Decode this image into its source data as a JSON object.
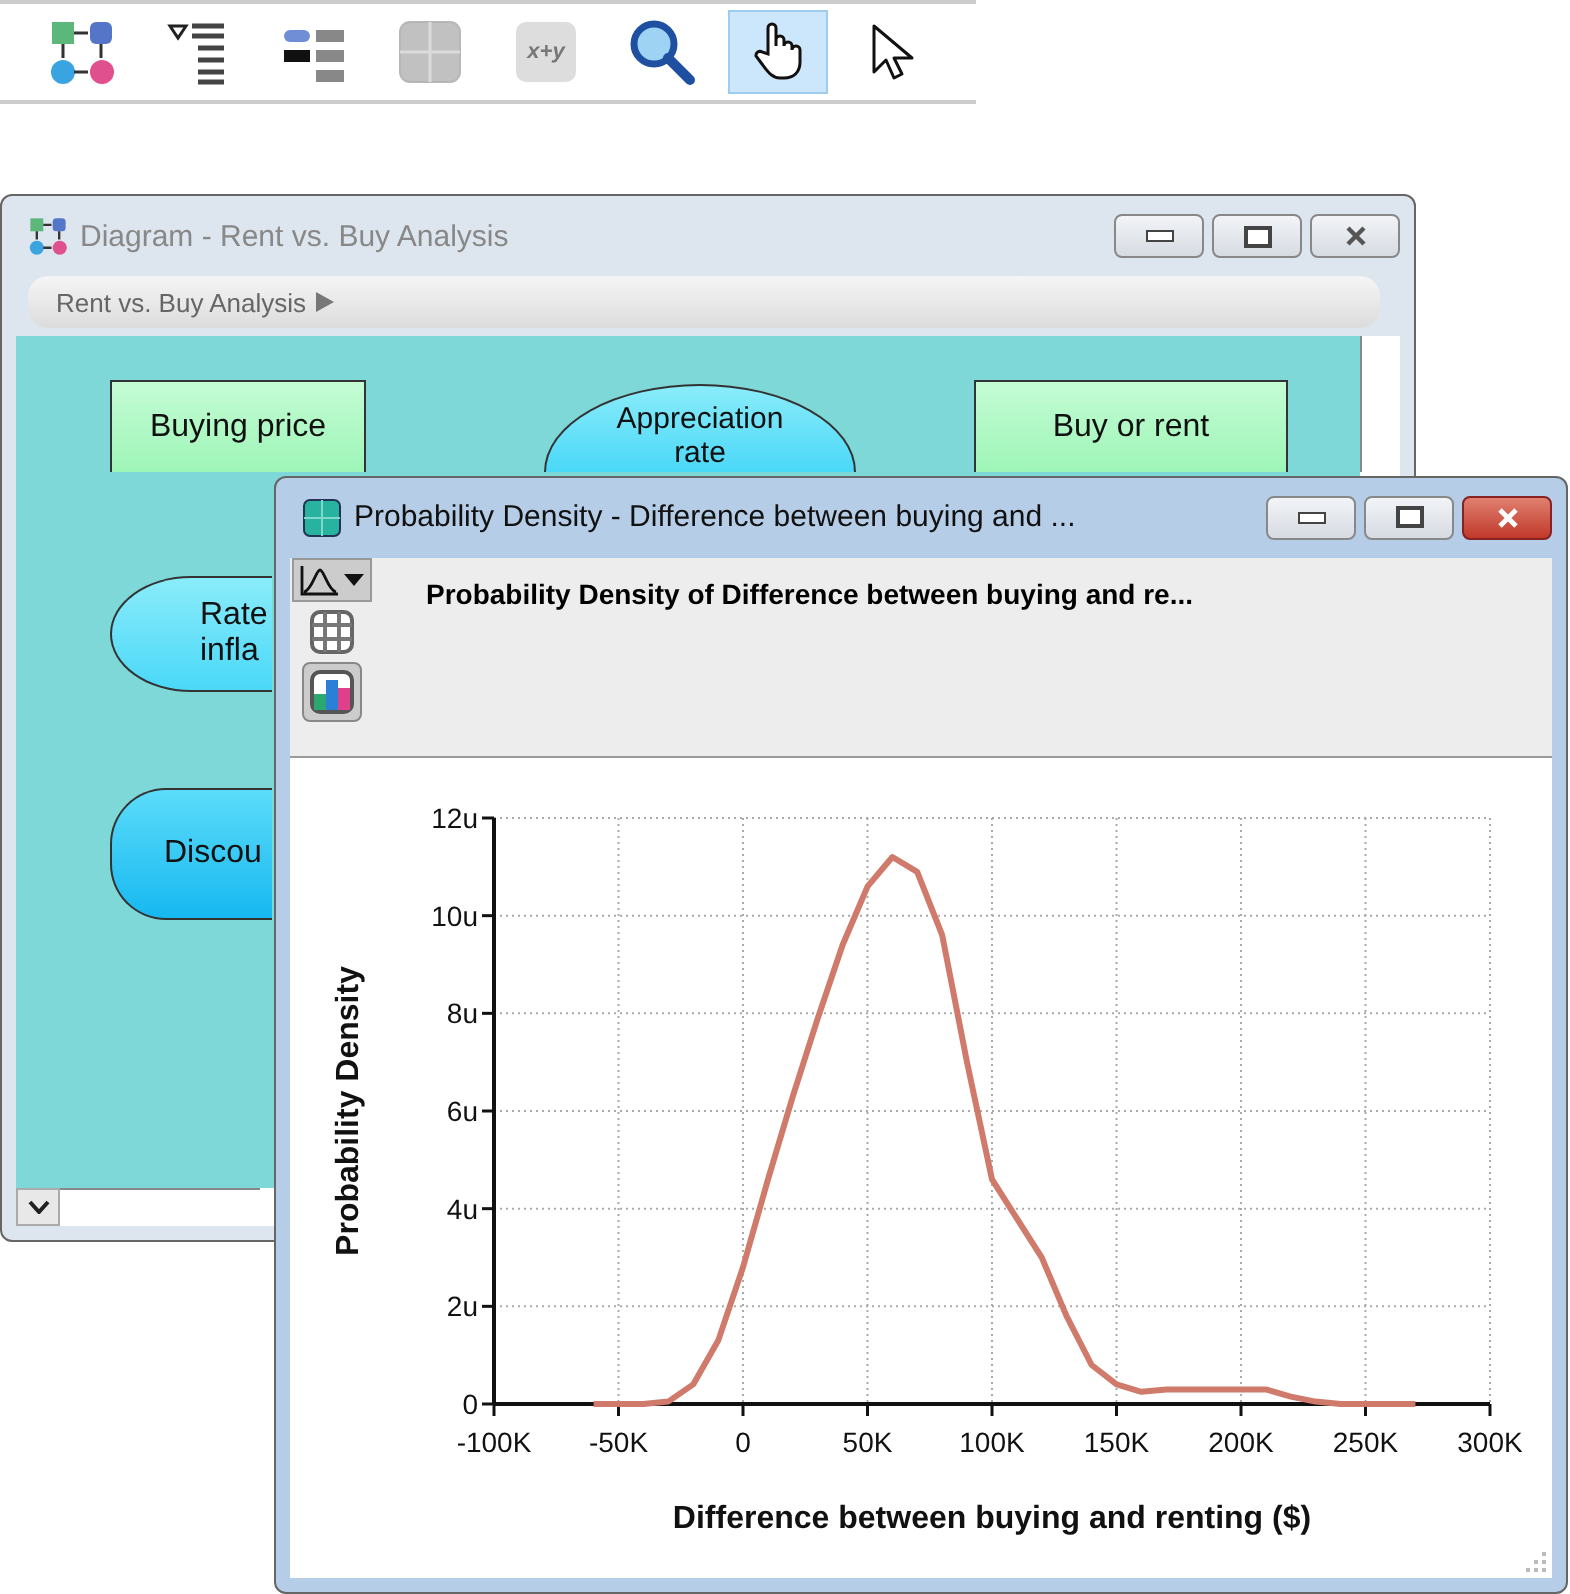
{
  "toolbar": [
    {
      "kind": "diagram",
      "selected": false,
      "disabled": false
    },
    {
      "kind": "outline",
      "selected": false,
      "disabled": false
    },
    {
      "kind": "attributes",
      "selected": false,
      "disabled": false
    },
    {
      "kind": "grid",
      "selected": false,
      "disabled": true
    },
    {
      "kind": "expression",
      "label": "x+y",
      "selected": false,
      "disabled": true
    },
    {
      "kind": "search",
      "selected": false,
      "disabled": false
    },
    {
      "kind": "hand",
      "selected": true,
      "disabled": false
    },
    {
      "kind": "pointer",
      "selected": false,
      "disabled": false
    }
  ],
  "diagram_window": {
    "title": "Diagram - Rent vs. Buy Analysis",
    "active": false,
    "breadcrumb": "Rent vs. Buy Analysis",
    "nodes": [
      {
        "kind": "decision",
        "label": "Buying price"
      },
      {
        "kind": "chance",
        "label": "Appreciation rate"
      },
      {
        "kind": "decision",
        "label": "Buy or rent"
      },
      {
        "kind": "chance",
        "label": "Rate infla"
      },
      {
        "kind": "objective",
        "label": "Discou"
      }
    ]
  },
  "chart_window": {
    "title": "Probability Density - Difference between buying and ...",
    "active": true,
    "view_buttons": [
      {
        "kind": "chart-type",
        "selected": false
      },
      {
        "kind": "table",
        "selected": false
      },
      {
        "kind": "graph",
        "selected": true
      }
    ],
    "chart_title": "Probability Density of Difference between buying and re...",
    "chart_data": {
      "type": "line",
      "xlabel": "Difference between buying and renting ($)",
      "ylabel": "Probability Density",
      "x": [
        -60000,
        -50000,
        -40000,
        -30000,
        -20000,
        -10000,
        0,
        10000,
        20000,
        30000,
        40000,
        50000,
        60000,
        70000,
        80000,
        90000,
        100000,
        110000,
        120000,
        130000,
        140000,
        150000,
        160000,
        170000,
        180000,
        190000,
        200000,
        210000,
        220000,
        230000,
        240000,
        250000,
        260000,
        270000
      ],
      "values": [
        0,
        0,
        0,
        0.05,
        0.4,
        1.3,
        2.8,
        4.6,
        6.3,
        7.9,
        9.4,
        10.6,
        11.2,
        10.9,
        9.6,
        7.0,
        4.6,
        3.8,
        3.0,
        1.8,
        0.8,
        0.4,
        0.25,
        0.3,
        0.3,
        0.3,
        0.3,
        0.3,
        0.15,
        0.05,
        0,
        0,
        0,
        0
      ],
      "grid": true,
      "xlim": [
        -100000,
        300000
      ],
      "ylim": [
        0,
        12
      ],
      "xticks": [
        {
          "value": -100000,
          "label": "-100K"
        },
        {
          "value": -50000,
          "label": "-50K"
        },
        {
          "value": 0,
          "label": "0"
        },
        {
          "value": 50000,
          "label": "50K"
        },
        {
          "value": 100000,
          "label": "100K"
        },
        {
          "value": 150000,
          "label": "150K"
        },
        {
          "value": 200000,
          "label": "200K"
        },
        {
          "value": 250000,
          "label": "250K"
        },
        {
          "value": 300000,
          "label": "300K"
        }
      ],
      "yticks": [
        {
          "value": 0,
          "label": "0"
        },
        {
          "value": 2,
          "label": "2u"
        },
        {
          "value": 4,
          "label": "4u"
        },
        {
          "value": 6,
          "label": "6u"
        },
        {
          "value": 8,
          "label": "8u"
        },
        {
          "value": 10,
          "label": "10u"
        },
        {
          "value": 12,
          "label": "12u"
        }
      ]
    }
  }
}
